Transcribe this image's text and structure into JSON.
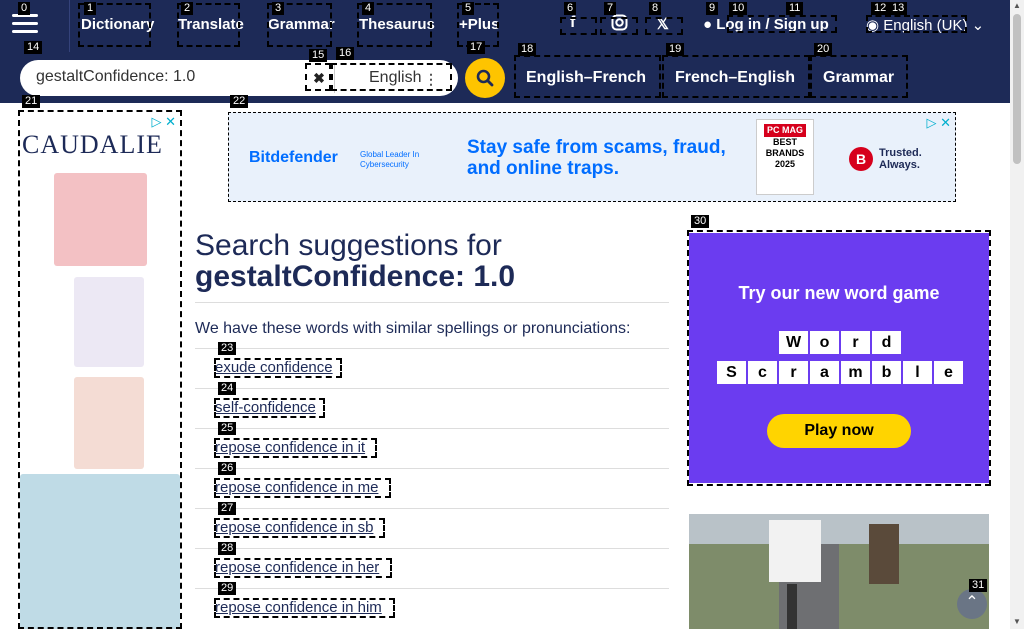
{
  "header": {
    "nav": [
      {
        "label": "Dictionary"
      },
      {
        "label": "Translate"
      },
      {
        "label": "Grammar"
      },
      {
        "label": "Thesaurus"
      },
      {
        "label": "+Plus"
      }
    ],
    "login": {
      "login": "Log in",
      "sep": "/",
      "signup": "Sign up"
    },
    "language": "English (UK)"
  },
  "search": {
    "value": "gestaltConfidence: 1.0",
    "dictionary": "English",
    "tabs": [
      "English–French",
      "French–English",
      "Grammar"
    ]
  },
  "ads": {
    "left_brand": "CAUDALIE",
    "top": {
      "brand": "Bitdefender",
      "tagline": "Global Leader In Cybersecurity",
      "message": "Stay safe from scams, fraud, and online traps.",
      "award_mag": "PC MAG",
      "award": "BEST BRANDS 2025",
      "trusted": "Trusted. Always."
    },
    "game": {
      "title": "Try our new word game",
      "word1": [
        "W",
        "o",
        "r",
        "d"
      ],
      "word2": [
        "S",
        "c",
        "r",
        "a",
        "m",
        "b",
        "l",
        "e"
      ],
      "cta": "Play now"
    }
  },
  "main": {
    "heading": "Search suggestions for",
    "query": "gestaltConfidence: 1.0",
    "intro": "We have these words with similar spellings or pronunciations:",
    "suggestions": [
      "exude confidence",
      "self-confidence",
      "repose confidence in it",
      "repose confidence in me",
      "repose confidence in sb",
      "repose confidence in her",
      "repose confidence in him"
    ]
  },
  "labels": [
    "0",
    "1",
    "2",
    "3",
    "4",
    "5",
    "6",
    "7",
    "8",
    "9",
    "10",
    "11",
    "12",
    "13",
    "14",
    "15",
    "16",
    "17",
    "18",
    "19",
    "20",
    "21",
    "22",
    "23",
    "24",
    "25",
    "26",
    "27",
    "28",
    "29",
    "30",
    "31"
  ]
}
